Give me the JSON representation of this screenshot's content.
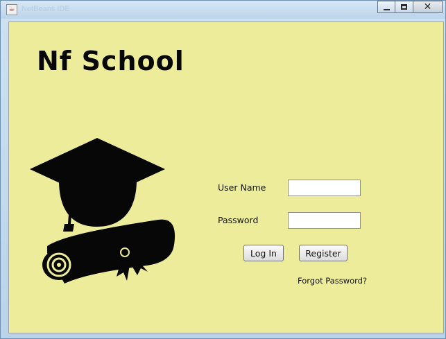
{
  "window": {
    "title": "NetBeans IDE",
    "controls": {
      "minimize": "minimize",
      "maximize": "maximize",
      "close": "close"
    }
  },
  "header": {
    "brand": "Nf School"
  },
  "login_form": {
    "username_label": "User Name",
    "username_value": "",
    "password_label": "Password",
    "password_value": "",
    "login_button": "Log In",
    "register_button": "Register",
    "forgot_link": "Forgot Password?"
  },
  "icons": {
    "app_icon": "java-app-icon",
    "logo": "graduation-cap-and-diploma-icon"
  },
  "colors": {
    "background": "#ecec9b",
    "logo": "#070707"
  }
}
